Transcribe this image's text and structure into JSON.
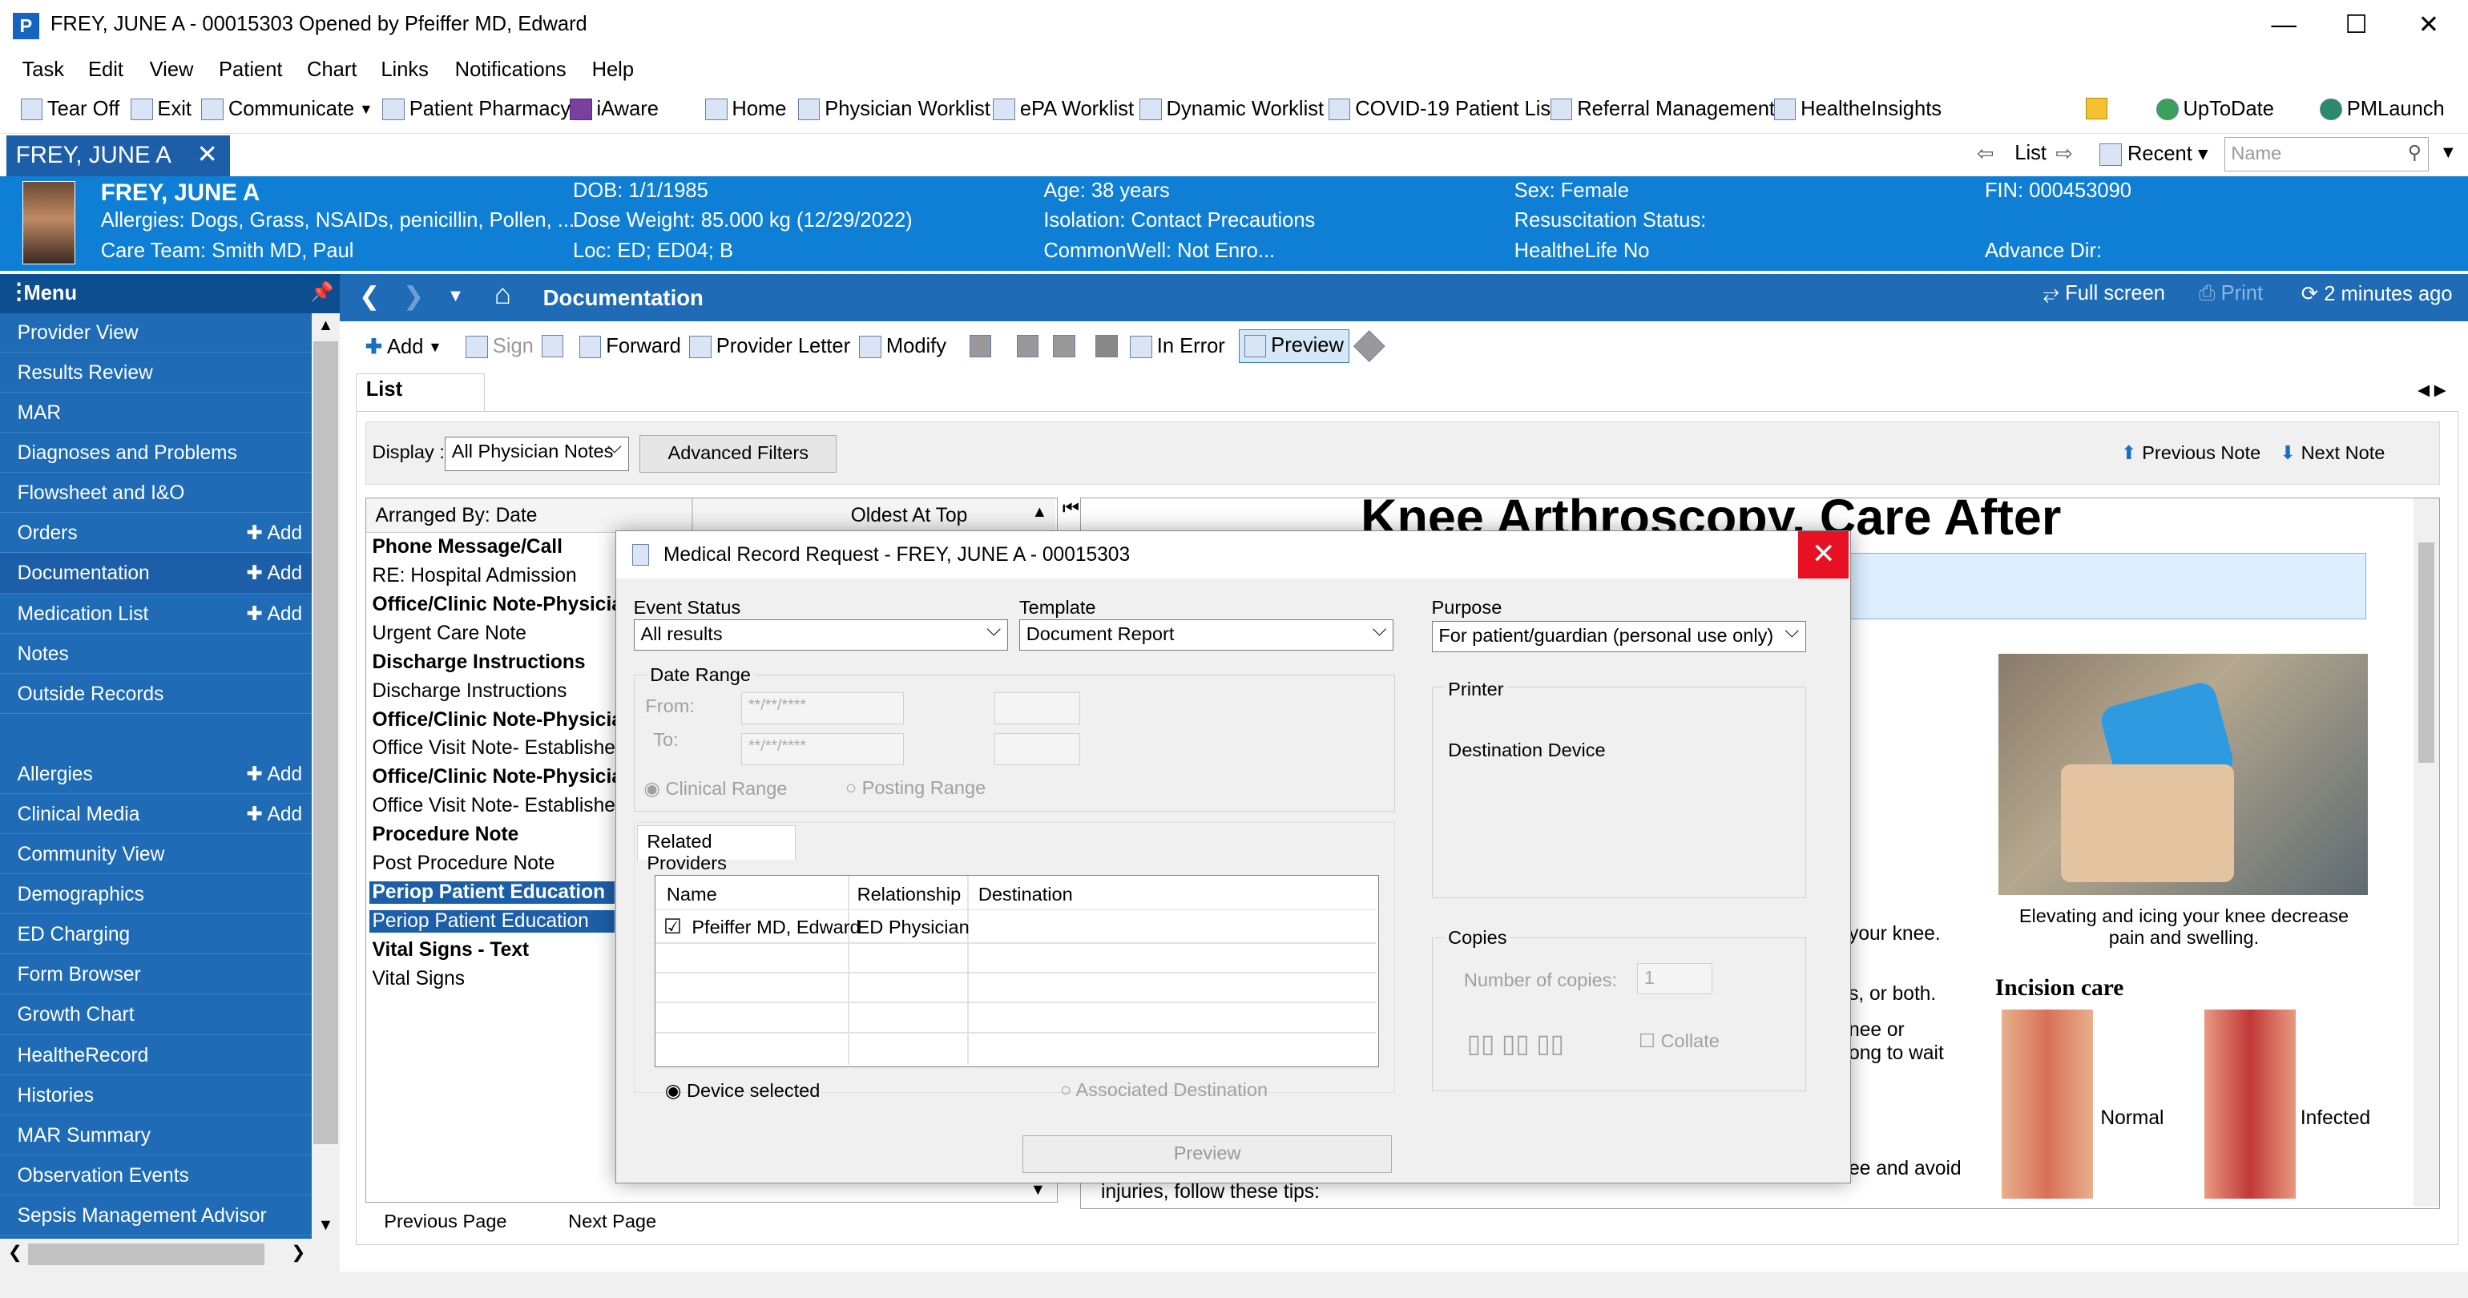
{
  "window": {
    "title": "FREY, JUNE A - 00015303 Opened by Pfeiffer MD, Edward",
    "app_icon": "P"
  },
  "menu": [
    "Task",
    "Edit",
    "View",
    "Patient",
    "Chart",
    "Links",
    "Notifications",
    "Help"
  ],
  "toolbar": {
    "tear_off": "Tear Off",
    "exit": "Exit",
    "communicate": "Communicate",
    "patient_pharmacy": "Patient Pharmacy",
    "iaware": "iAware",
    "home": "Home",
    "physician_worklist": "Physician Worklist",
    "epa_worklist": "ePA Worklist",
    "dynamic_worklist": "Dynamic Worklist",
    "covid_list": "COVID-19 Patient List",
    "referral": "Referral Management",
    "healtheinsights": "HealtheInsights",
    "uptodate": "UpToDate",
    "pmlaunch": "PMLaunch"
  },
  "tabs": {
    "patient_tab": "FREY, JUNE A",
    "list": "List",
    "recent": "Recent",
    "name_placeholder": "Name"
  },
  "banner": {
    "name": "FREY, JUNE A",
    "allergies": "Allergies: Dogs, Grass, NSAIDs, penicillin, Pollen, ...",
    "care_team": "Care Team: Smith MD, Paul",
    "dob": "DOB: 1/1/1985",
    "dose_weight": "Dose Weight: 85.000 kg (12/29/2022)",
    "loc": "Loc: ED; ED04; B",
    "age": "Age: 38 years",
    "isolation": "Isolation: Contact Precautions",
    "commonwell": "CommonWell: Not Enro...",
    "sex": "Sex: Female",
    "resus": "Resuscitation Status:",
    "healthelife": "HealtheLife No",
    "fin": "FIN: 000453090",
    "advance_dir": "Advance Dir:"
  },
  "sidebar": {
    "header": "Menu",
    "add_label": "Add",
    "items": [
      {
        "label": "Provider View",
        "add": false
      },
      {
        "label": "Results Review",
        "add": false
      },
      {
        "label": "MAR",
        "add": false
      },
      {
        "label": "Diagnoses and Problems",
        "add": false
      },
      {
        "label": "Flowsheet and I&O",
        "add": false
      },
      {
        "label": "Orders",
        "add": true
      },
      {
        "label": "Documentation",
        "add": true
      },
      {
        "label": "Medication List",
        "add": true
      },
      {
        "label": "Notes",
        "add": false
      },
      {
        "label": "Outside Records",
        "add": false
      },
      {
        "label": "",
        "add": false
      },
      {
        "label": "Allergies",
        "add": true
      },
      {
        "label": "Clinical Media",
        "add": true
      },
      {
        "label": "Community View",
        "add": false
      },
      {
        "label": "Demographics",
        "add": false
      },
      {
        "label": "ED Charging",
        "add": false
      },
      {
        "label": "Form Browser",
        "add": false
      },
      {
        "label": "Growth Chart",
        "add": false
      },
      {
        "label": "HealtheRecord",
        "add": false
      },
      {
        "label": "Histories",
        "add": false
      },
      {
        "label": "MAR Summary",
        "add": false
      },
      {
        "label": "Observation Events",
        "add": false
      },
      {
        "label": "Sepsis Management Advisor",
        "add": false
      }
    ]
  },
  "main": {
    "title": "Documentation",
    "full_screen": "Full screen",
    "print": "Print",
    "refresh": "2 minutes ago"
  },
  "doc_toolbar": {
    "add": "Add",
    "sign": "Sign",
    "forward": "Forward",
    "provider_letter": "Provider Letter",
    "modify": "Modify",
    "in_error": "In Error",
    "preview": "Preview"
  },
  "list": {
    "tab": "List",
    "display_label": "Display :",
    "display_value": "All Physician Notes",
    "advanced_filters": "Advanced Filters",
    "previous_note": "Previous Note",
    "next_note": "Next Note",
    "arranged_by": "Arranged By: Date",
    "oldest": "Oldest At Top",
    "previous_page": "Previous Page",
    "next_page": "Next Page"
  },
  "notes": [
    {
      "text": "Phone Message/Call",
      "bold": true,
      "sel": false
    },
    {
      "text": "RE: Hospital Admission",
      "bold": false,
      "sel": false
    },
    {
      "text": "Office/Clinic Note-Physician",
      "bold": true,
      "sel": false
    },
    {
      "text": "Urgent Care Note",
      "bold": false,
      "sel": false
    },
    {
      "text": "Discharge Instructions",
      "bold": true,
      "sel": false
    },
    {
      "text": "Discharge Instructions",
      "bold": false,
      "sel": false
    },
    {
      "text": "Office/Clinic Note-Physician",
      "bold": true,
      "sel": false
    },
    {
      "text": "Office Visit Note- Established",
      "bold": false,
      "sel": false
    },
    {
      "text": "Office/Clinic Note-Physician",
      "bold": true,
      "sel": false
    },
    {
      "text": "Office Visit Note- Established",
      "bold": false,
      "sel": false
    },
    {
      "text": "Procedure Note",
      "bold": true,
      "sel": false
    },
    {
      "text": "Post Procedure Note",
      "bold": false,
      "sel": false
    },
    {
      "text": "Periop Patient Education",
      "bold": true,
      "sel": true
    },
    {
      "text": "Periop Patient Education",
      "bold": false,
      "sel": true
    },
    {
      "text": "Vital Signs - Text",
      "bold": true,
      "sel": false
    },
    {
      "text": "Vital Signs",
      "bold": false,
      "sel": false
    }
  ],
  "preview": {
    "heading": "Knee Arthroscopy, Care After",
    "caption": "Elevating and icing your knee decrease pain and swelling.",
    "incision_care": "Incision care",
    "normal": "Normal",
    "infected": "Infected",
    "frag1": "your knee.",
    "frag2": "s, or both.",
    "frag3": "nee or",
    "frag4": "ong to wait",
    "frag5": "ee and avoid",
    "frag6": "injuries, follow these tips:"
  },
  "dialog": {
    "title": "Medical Record Request -  FREY, JUNE A - 00015303",
    "event_status_label": "Event Status",
    "event_status": "All results",
    "template_label": "Template",
    "template": "Document Report",
    "purpose_label": "Purpose",
    "purpose": "For patient/guardian (personal use only)",
    "date_range": "Date Range",
    "from": "From:",
    "to": "To:",
    "date_placeholder": "**/**/****",
    "clinical_range": "Clinical Range",
    "posting_range": "Posting Range",
    "related_providers": "Related Providers",
    "col_name": "Name",
    "col_relationship": "Relationship",
    "col_destination": "Destination",
    "provider_name": "Pfeiffer MD, Edward",
    "provider_rel": "ED Physician",
    "device_selected": "Device selected",
    "associated_destination": "Associated Destination",
    "printer": "Printer",
    "destination_device": "Destination Device",
    "copies": "Copies",
    "number_of_copies": "Number of copies:",
    "copies_value": "1",
    "collate": "Collate",
    "preview_btn": "Preview"
  },
  "colors": {
    "banner": "#0e7fd4",
    "sidebar": "#1f6bb6",
    "selected": "#1d5ea8",
    "close": "#e81123"
  }
}
